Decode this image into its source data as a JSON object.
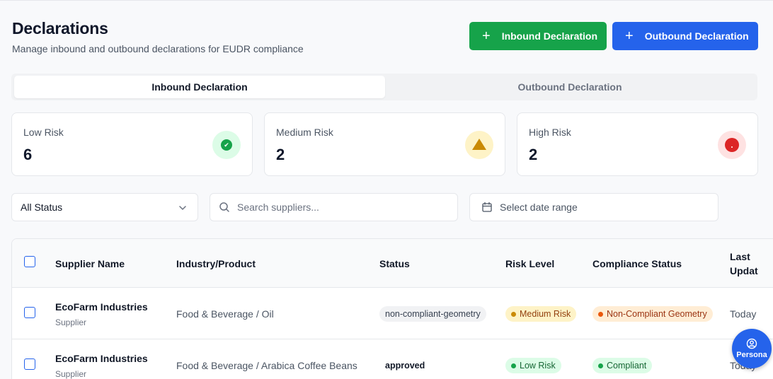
{
  "header": {
    "title": "Declarations",
    "subtitle": "Manage inbound and outbound declarations for EUDR compliance",
    "inbound_button": "Inbound Declaration",
    "outbound_button": "Outbound Declaration"
  },
  "tabs": [
    {
      "label": "Inbound Declaration",
      "active": true
    },
    {
      "label": "Outbound Declaration",
      "active": false
    }
  ],
  "summary_cards": [
    {
      "label": "Low Risk",
      "value": "6",
      "icon": "check-circle-icon",
      "color": "#16a34a"
    },
    {
      "label": "Medium Risk",
      "value": "2",
      "icon": "warning-triangle-icon",
      "color": "#ca8a04"
    },
    {
      "label": "High Risk",
      "value": "2",
      "icon": "alert-circle-icon",
      "color": "#dc2626"
    }
  ],
  "filters": {
    "status_selected": "All Status",
    "search_placeholder": "Search suppliers...",
    "date_placeholder": "Select date range"
  },
  "table": {
    "columns": [
      "Supplier Name",
      "Industry/Product",
      "Status",
      "Risk Level",
      "Compliance Status",
      "Last",
      "Updat"
    ],
    "rows": [
      {
        "supplier": "EcoFarm Industries",
        "type": "Supplier",
        "industry": "Food & Beverage / Oil",
        "status": "non-compliant-geometry",
        "risk": "Medium Risk",
        "compliance": "Non-Compliant Geometry",
        "updated": "Today"
      },
      {
        "supplier": "EcoFarm Industries",
        "type": "Supplier",
        "industry": "Food & Beverage / Arabica Coffee Beans",
        "status": "approved",
        "risk": "Low Risk",
        "compliance": "Compliant",
        "updated": "Today"
      }
    ]
  },
  "persona": {
    "label": "Persona",
    "icon": "user-circle-icon"
  },
  "colors": {
    "primary_green": "#16a34a",
    "primary_blue": "#2563eb"
  }
}
